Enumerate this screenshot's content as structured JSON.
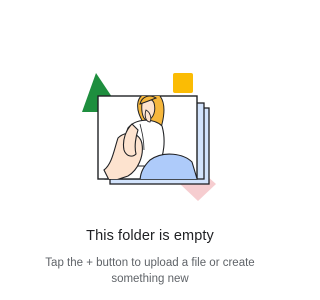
{
  "empty_state": {
    "title": "This folder is empty",
    "message": "Tap the + button to upload a file or create something new",
    "illustration": "person-in-photo-frame-illustration"
  },
  "colors": {
    "green_triangle": "#1e8e3e",
    "yellow_square": "#fbbc04",
    "pink_diamond": "#f6cdd0",
    "frame_blue": "#d2e3fc",
    "hair": "#f6b73c",
    "skin": "#fde3cf",
    "jeans": "#aecbfa",
    "outline": "#202124"
  }
}
